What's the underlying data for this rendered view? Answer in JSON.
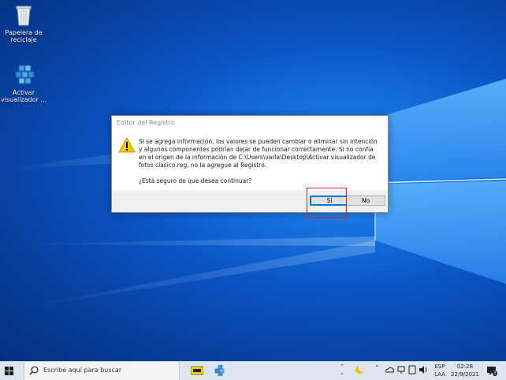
{
  "desktop": {
    "icons": [
      {
        "label": "Papelera de reciclaje"
      },
      {
        "label": "Activar visualizador ..."
      }
    ]
  },
  "dialog": {
    "title": "Editor del Registro",
    "message": "Si se agrega información, los valores se pueden cambiar o eliminar sin intención y algunos componentes podrían dejar de funcionar correctamente. Si no confía en el origen de la información de C:\\Users\\varla\\Desktop\\Activar visualizador de fotos clasico.reg, no la agregue al Registro.",
    "question": "¿Está seguro de que desea continuar?",
    "yes_label": "Sí",
    "no_label": "No"
  },
  "taskbar": {
    "search_placeholder": "Escribe aquí para buscar",
    "language_line1": "ESP",
    "language_line2": "LAA",
    "time": "02:28",
    "date": "22/9/2021",
    "notification_count": "3"
  },
  "colors": {
    "accent": "#0078d7",
    "highlight_box": "#e02020",
    "taskbar": "#dde6ef"
  }
}
